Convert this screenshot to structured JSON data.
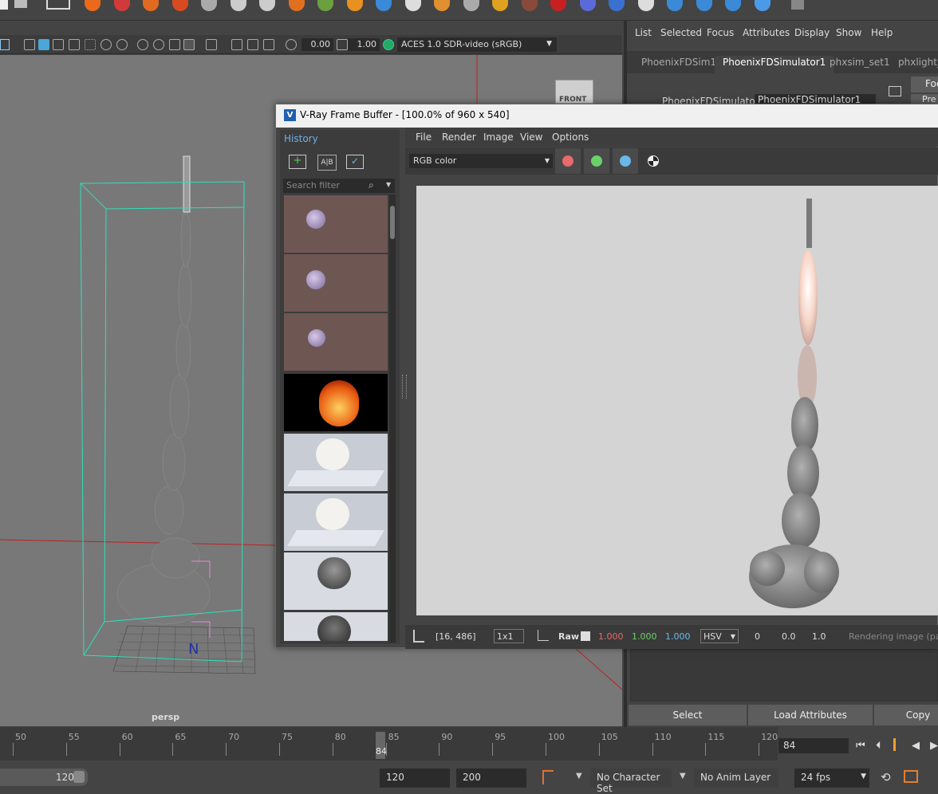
{
  "viewport": {
    "exposure_value": "0.00",
    "gamma_value": "1.00",
    "colorspace": "ACES 1.0 SDR-video (sRGB)",
    "camera_label": "persp",
    "viewcube_label": "FRONT",
    "axis_label": "N"
  },
  "attribute_editor": {
    "menu": [
      "List",
      "Selected",
      "Focus",
      "Attributes",
      "Display",
      "Show",
      "Help"
    ],
    "tabs": [
      "PhoenixFDSim1",
      "PhoenixFDSimulator1",
      "phxsim_set1",
      "phxlight_"
    ],
    "active_tab": "PhoenixFDSimulator1",
    "node_label": "PhoenixFDSimulator:",
    "node_value": "PhoenixFDSimulator1",
    "focus_label": "Foc",
    "presets_label": "Pre",
    "buttons": [
      "Select",
      "Load Attributes",
      "Copy"
    ]
  },
  "timeline": {
    "ticks": [
      "50",
      "55",
      "60",
      "65",
      "70",
      "75",
      "80",
      "85",
      "90",
      "95",
      "100",
      "105",
      "110",
      "115",
      "120"
    ],
    "current_frame_marker": "84",
    "current_frame_field": "84"
  },
  "range_bar": {
    "range_slider_value": "120",
    "end_time": "120",
    "anim_end": "200",
    "character_set": "No Character Set",
    "anim_layer": "No Anim Layer",
    "fps": "24 fps"
  },
  "vfb": {
    "title": "V-Ray Frame Buffer - [100.0% of 960 x 540]",
    "history_tab": "History",
    "search_placeholder": "Search filter",
    "menu": [
      "File",
      "Render",
      "Image",
      "View",
      "Options"
    ],
    "channel": "RGB color",
    "status": {
      "coords": "[16, 486]",
      "sampling": "1x1",
      "raw_label": "Raw",
      "r": "1.000",
      "g": "1.000",
      "b": "1.000",
      "color_mode": "HSV",
      "h": "0",
      "s": "0.0",
      "v": "1.0",
      "message": "Rendering image (pas"
    },
    "colors": {
      "red": "#e86a6a",
      "green": "#6ad06a",
      "blue": "#6ab8e8"
    }
  }
}
